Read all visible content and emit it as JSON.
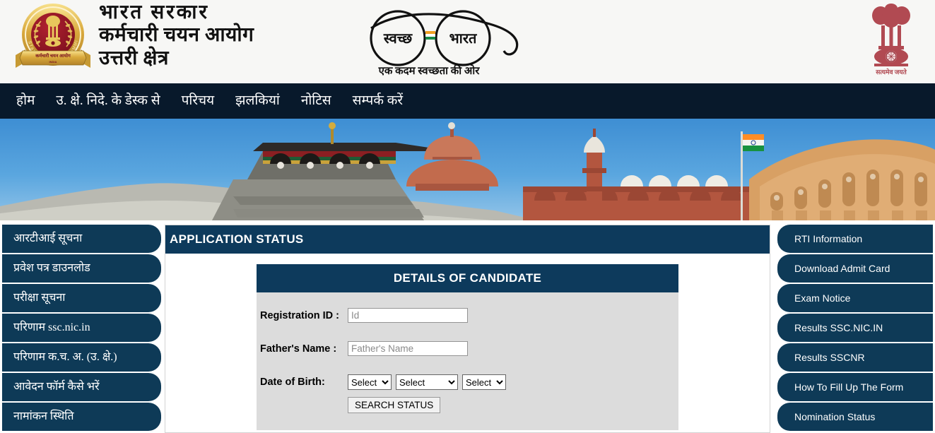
{
  "header": {
    "org_line1": "भारत  सरकार",
    "org_line2": "कर्मचारी चयन आयोग",
    "org_line3": "उत्तरी  क्षेत्र",
    "ssc_logo_alt": "Staff Selection Commission emblem",
    "ssc_ribbon_text": "कर्मचारी चयन आयोग",
    "ssc_arc_text": "STAFF SELECTION COMMISSION",
    "swachh_lens_left": "स्वच्छ",
    "swachh_lens_right": "भारत",
    "swachh_tagline": "एक कदम स्वच्छता की ओर",
    "emblem_motto": "सत्यमेव जयते"
  },
  "nav": {
    "items": [
      {
        "label": "होम"
      },
      {
        "label": "उ. क्षे. निदे. के डेस्क से"
      },
      {
        "label": "परिचय"
      },
      {
        "label": "झलकियां"
      },
      {
        "label": "नोटिस"
      },
      {
        "label": "सम्पर्क करें"
      }
    ]
  },
  "banner": {
    "alt": "Indian monuments banner: Kedarnath temple, Red Fort and Hawa Mahal against blue sky"
  },
  "sidebar_left": {
    "items": [
      {
        "label": "आरटीआई सूचना"
      },
      {
        "label": "प्रवेश पत्र डाउनलोड"
      },
      {
        "label": "परीक्षा सूचना"
      },
      {
        "label": "परिणाम ssc.nic.in"
      },
      {
        "label": "परिणाम क.च. अ. (उ. क्षे.)"
      },
      {
        "label": "आवेदन फॉर्म कैसे भरें"
      },
      {
        "label": "नामांकन स्थिति"
      }
    ]
  },
  "sidebar_right": {
    "items": [
      {
        "label": "RTI Information"
      },
      {
        "label": "Download Admit Card"
      },
      {
        "label": "Exam Notice"
      },
      {
        "label": "Results SSC.NIC.IN"
      },
      {
        "label": "Results SSCNR"
      },
      {
        "label": "How To Fill Up The Form"
      },
      {
        "label": "Nomination Status"
      }
    ]
  },
  "main": {
    "panel_title": "APPLICATION STATUS",
    "form_title": "DETAILS OF CANDIDATE",
    "fields": {
      "registration_label": "Registration ID :",
      "registration_value": "",
      "registration_placeholder": "Id",
      "father_label": "Father's Name :",
      "father_value": "",
      "father_placeholder": "Father's Name",
      "dob_label": "Date of Birth:",
      "dob_day": "Select",
      "dob_month": "Select",
      "dob_year": "Select"
    },
    "search_button": "SEARCH STATUS"
  },
  "colors": {
    "nav_bg": "#08192b",
    "panel_header": "#0d3a5c",
    "sidebar_btn": "#0e3a57",
    "form_body": "#dcdcdc",
    "banner_sky": "#3e8ed3"
  }
}
